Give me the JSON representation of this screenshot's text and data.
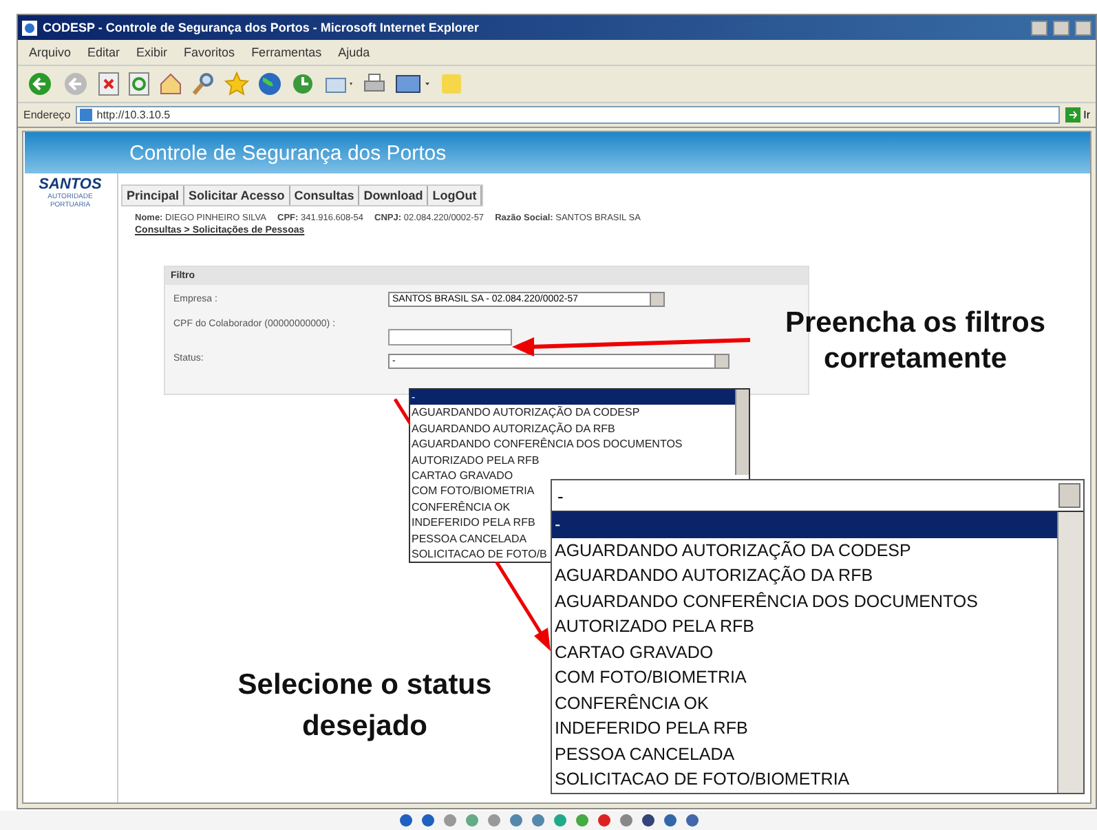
{
  "window": {
    "title": "CODESP - Controle de Segurança dos Portos - Microsoft Internet Explorer",
    "menu": [
      "Arquivo",
      "Editar",
      "Exibir",
      "Favoritos",
      "Ferramentas",
      "Ajuda"
    ],
    "address_label": "Endereço",
    "address": "http://10.3.10.5",
    "go_label": "Ir"
  },
  "page": {
    "header_title": "Controle de Segurança dos Portos",
    "logo": {
      "name": "SANTOS",
      "subtitle": "AUTORIDADE PORTUARIA"
    },
    "nav": [
      "Principal",
      "Solicitar Acesso",
      "Consultas",
      "Download",
      "LogOut"
    ],
    "user_info": [
      {
        "label": "Nome:",
        "value": "DIEGO PINHEIRO SILVA"
      },
      {
        "label": "CPF:",
        "value": "341.916.608-54"
      },
      {
        "label": "CNPJ:",
        "value": "02.084.220/0002-57"
      },
      {
        "label": "Razão Social:",
        "value": "SANTOS BRASIL SA"
      }
    ],
    "breadcrumb": "Consultas > Solicitações de Pessoas",
    "filter": {
      "title": "Filtro",
      "empresa_label": "Empresa :",
      "empresa_value": "SANTOS BRASIL SA - 02.084.220/0002-57",
      "cpf_label": "CPF do Colaborador (00000000000) :",
      "status_label": "Status:",
      "status_value": "-",
      "status_options": [
        {
          "label": "-",
          "selected": true
        },
        {
          "label": "AGUARDANDO AUTORIZAÇÃO DA CODESP",
          "selected": false
        },
        {
          "label": "AGUARDANDO AUTORIZAÇÃO DA RFB",
          "selected": false
        },
        {
          "label": "AGUARDANDO CONFERÊNCIA DOS DOCUMENTOS",
          "selected": false
        },
        {
          "label": "AUTORIZADO PELA RFB",
          "selected": false
        },
        {
          "label": "CARTAO GRAVADO",
          "selected": false
        },
        {
          "label": "COM FOTO/BIOMETRIA",
          "selected": false
        },
        {
          "label": "CONFERÊNCIA OK",
          "selected": false
        },
        {
          "label": "INDEFERIDO PELA RFB",
          "selected": false
        },
        {
          "label": "PESSOA CANCELADA",
          "selected": false
        },
        {
          "label": "SOLICITACAO DE FOTO/B",
          "selected": false
        }
      ]
    }
  },
  "zoomed_status": {
    "value": "-",
    "options": [
      {
        "label": "-",
        "selected": true
      },
      {
        "label": "AGUARDANDO AUTORIZAÇÃO DA CODESP",
        "selected": false
      },
      {
        "label": "AGUARDANDO AUTORIZAÇÃO DA RFB",
        "selected": false
      },
      {
        "label": "AGUARDANDO CONFERÊNCIA DOS DOCUMENTOS",
        "selected": false
      },
      {
        "label": "AUTORIZADO PELA RFB",
        "selected": false
      },
      {
        "label": "CARTAO GRAVADO",
        "selected": false
      },
      {
        "label": "COM FOTO/BIOMETRIA",
        "selected": false
      },
      {
        "label": "CONFERÊNCIA OK",
        "selected": false
      },
      {
        "label": "INDEFERIDO PELA RFB",
        "selected": false
      },
      {
        "label": "PESSOA CANCELADA",
        "selected": false
      },
      {
        "label": "SOLICITACAO DE FOTO/BIOMETRIA",
        "selected": false
      }
    ]
  },
  "annotations": [
    "Preencha os filtros corretamente",
    "Selecione o status desejado"
  ]
}
